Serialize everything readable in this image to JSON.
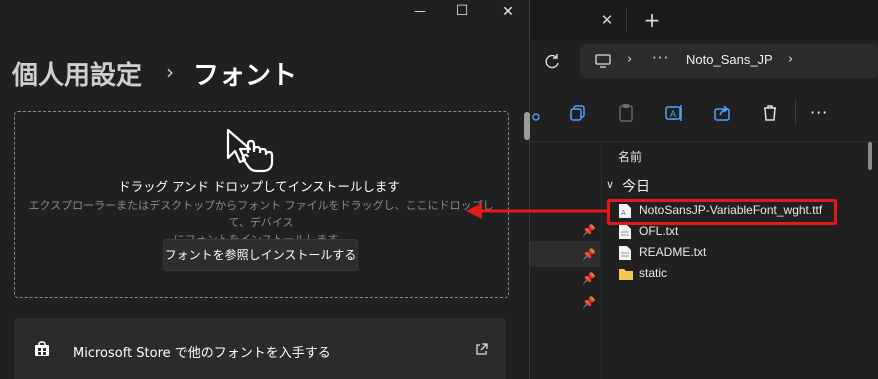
{
  "settings": {
    "breadcrumb": {
      "parent": "個人用設定",
      "separator": "›",
      "current": "フォント"
    },
    "window_controls": {
      "minimize": "—",
      "maximize": "☐",
      "close": "✕"
    },
    "drop_zone": {
      "title": "ドラッグ アンド ドロップしてインストールします",
      "description_line1": "エクスプローラーまたはデスクトップからフォント ファイルをドラッグし、ここにドロップして、デバイス",
      "description_line2": "にフォントをインストールします。",
      "browse_button": "フォントを参照しインストールする"
    },
    "store_link": {
      "label": "Microsoft Store で他のフォントを入手する"
    }
  },
  "explorer": {
    "tab": {
      "close": "✕",
      "add": "+"
    },
    "address": {
      "more": "···",
      "folder": "Noto_Sans_JP"
    },
    "command_bar": {
      "more": "···"
    },
    "column_header": "名前",
    "group": {
      "label": "今日"
    },
    "files": [
      {
        "name": "NotoSansJP-VariableFont_wght.ttf",
        "type": "font"
      },
      {
        "name": "OFL.txt",
        "type": "text"
      },
      {
        "name": "README.txt",
        "type": "text"
      },
      {
        "name": "static",
        "type": "folder"
      }
    ]
  },
  "colors": {
    "annotation": "#e21a1a",
    "folder": "#f2c94c",
    "accent": "#4aa3ff"
  }
}
